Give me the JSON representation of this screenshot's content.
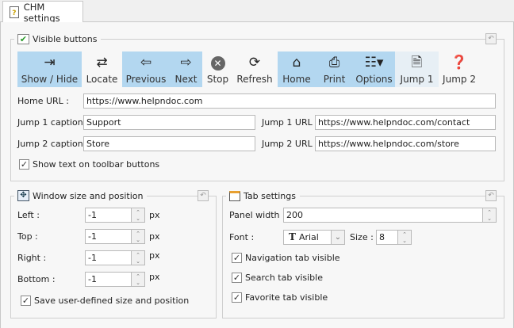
{
  "tab": {
    "label": "CHM settings",
    "icon": "help-file-icon"
  },
  "visible_buttons": {
    "title": "Visible buttons",
    "buttons": [
      {
        "label": "Show / Hide",
        "icon": "show-hide-icon",
        "active": true
      },
      {
        "label": "Locate",
        "icon": "locate-icon",
        "active": false
      },
      {
        "label": "Previous",
        "icon": "arrow-left-icon",
        "active": true
      },
      {
        "label": "Next",
        "icon": "arrow-right-icon",
        "active": true
      },
      {
        "label": "Stop",
        "icon": "stop-icon",
        "active": false
      },
      {
        "label": "Refresh",
        "icon": "refresh-icon",
        "active": false
      },
      {
        "label": "Home",
        "icon": "home-icon",
        "active": true
      },
      {
        "label": "Print",
        "icon": "printer-icon",
        "active": true
      },
      {
        "label": "Options",
        "icon": "options-icon",
        "active": true
      },
      {
        "label": "Jump 1",
        "icon": "jump1-icon",
        "active": false
      },
      {
        "label": "Jump 2",
        "icon": "jump2-icon",
        "active": false
      }
    ],
    "home_url_label": "Home URL :",
    "home_url": "https://www.helpndoc.com",
    "jump1_caption_label": "Jump 1 caption :",
    "jump1_caption": "Support",
    "jump1_url_label": "Jump 1 URL :",
    "jump1_url": "https://www.helpndoc.com/contact",
    "jump2_caption_label": "Jump 2 caption :",
    "jump2_caption": "Store",
    "jump2_url_label": "Jump 2 URL :",
    "jump2_url": "https://www.helpndoc.com/store",
    "show_text_label": "Show text on toolbar buttons",
    "show_text_checked": true
  },
  "window": {
    "title": "Window size and position",
    "unit": "px",
    "fields": [
      {
        "label": "Left :",
        "value": "-1"
      },
      {
        "label": "Top :",
        "value": "-1"
      },
      {
        "label": "Right :",
        "value": "-1"
      },
      {
        "label": "Bottom :",
        "value": "-1"
      }
    ],
    "save_label": "Save user-defined size and position",
    "save_checked": true
  },
  "tabs": {
    "title": "Tab settings",
    "panel_width_label": "Panel width :",
    "panel_width": "200",
    "font_label": "Font :",
    "font": "Arial",
    "size_label": "Size :",
    "size": "8",
    "checks": [
      {
        "label": "Navigation tab visible",
        "checked": true
      },
      {
        "label": "Search tab visible",
        "checked": true
      },
      {
        "label": "Favorite tab visible",
        "checked": true
      }
    ]
  }
}
